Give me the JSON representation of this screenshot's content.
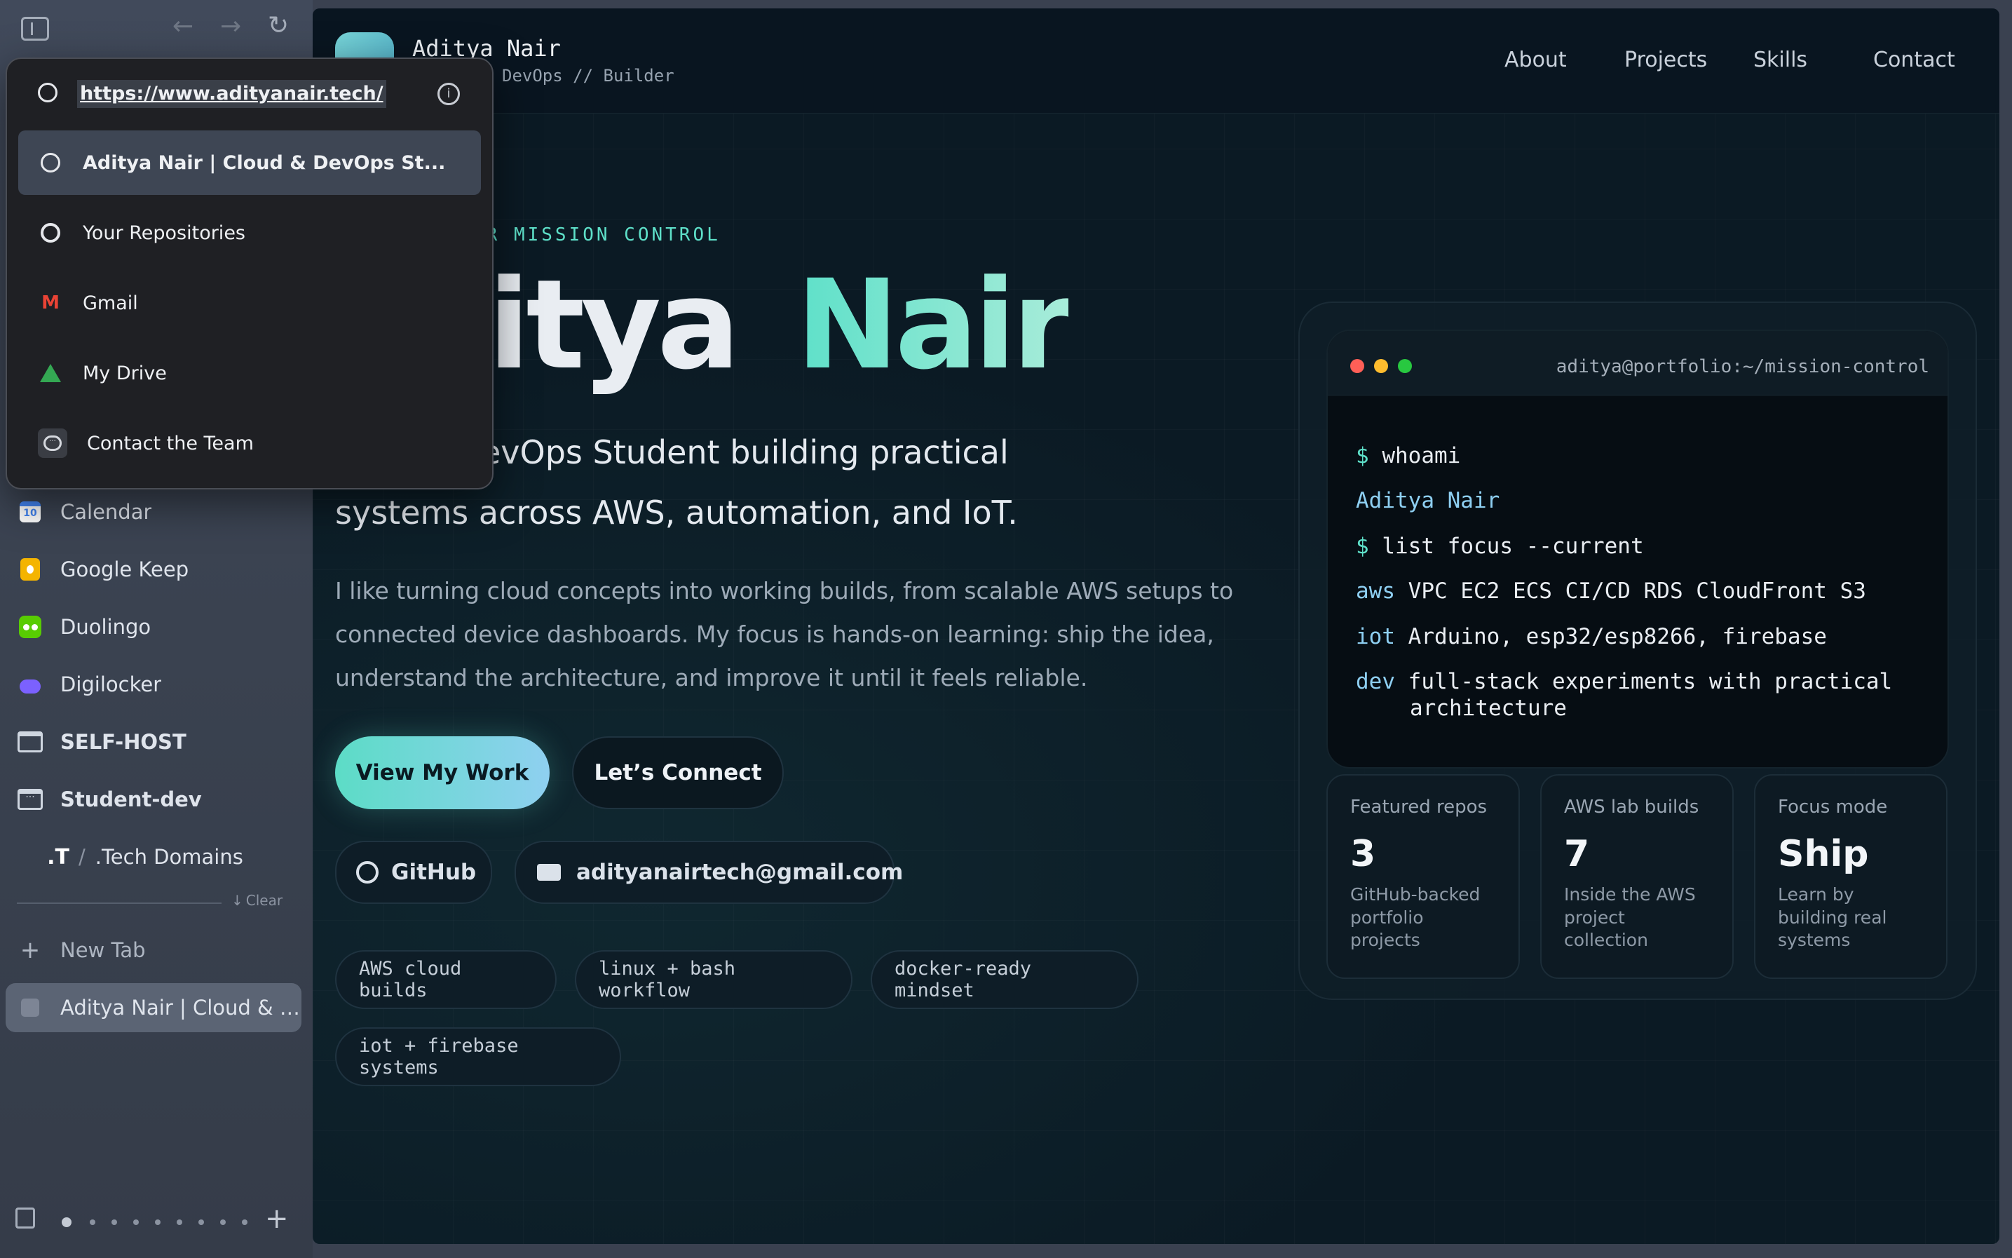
{
  "browser": {
    "url": "https://www.adityanair.tech/",
    "suggestions": [
      {
        "label": "Aditya Nair | Cloud & DevOps St...",
        "icon": "globe-icon"
      },
      {
        "label": "Your Repositories",
        "icon": "github-icon"
      },
      {
        "label": "Gmail",
        "icon": "gmail-icon"
      },
      {
        "label": "My Drive",
        "icon": "drive-icon"
      },
      {
        "label": "Contact the Team",
        "icon": "chat-icon"
      }
    ]
  },
  "sidebar": {
    "items": [
      {
        "label": "Calendar",
        "icon": "calendar-icon"
      },
      {
        "label": "Google Keep",
        "icon": "keep-icon"
      },
      {
        "label": "Duolingo",
        "icon": "duolingo-icon"
      },
      {
        "label": "Digilocker",
        "icon": "cloud-icon"
      },
      {
        "label": "SELF-HOST",
        "icon": "folder-icon"
      },
      {
        "label": "Student-dev",
        "icon": "folder-icon"
      },
      {
        "label": ".Tech Domains",
        "icon": "tech-icon"
      }
    ],
    "clear_label": "Clear",
    "new_tab_label": "New Tab",
    "active_tab_label": "Aditya Nair | Cloud & De..."
  },
  "site": {
    "brand_name": "Aditya Nair",
    "brand_sub": "DevOps // Builder",
    "nav": [
      "About",
      "Projects",
      "Skills",
      "Contact"
    ],
    "eyebrow": "ER MISSION CONTROL",
    "hero_title_a": "itya",
    "hero_title_b": "Nair",
    "subtitle_1": "evOps Student building practical",
    "subtitle_2": "systems across AWS, automation, and IoT.",
    "intro_1": "I like turning cloud concepts into working builds, from scalable AWS setups to",
    "intro_2": "connected device dashboards. My focus is hands-on learning: ship the idea,",
    "intro_3": "understand the architecture, and improve it until it feels reliable.",
    "cta_primary": "View My Work",
    "cta_secondary": "Let’s Connect",
    "github_label": "GitHub",
    "email_label": "adityanairtech@gmail.com",
    "tags": [
      "AWS cloud builds",
      "linux + bash workflow",
      "docker-ready mindset",
      "iot + firebase systems"
    ]
  },
  "terminal": {
    "title": "aditya@portfolio:~/mission-control",
    "prompt": "$",
    "cmd1": "whoami",
    "out1": "Aditya Nair",
    "cmd2": "list focus --current",
    "rows": [
      {
        "key": "aws",
        "val": "VPC EC2 ECS CI/CD RDS CloudFront S3"
      },
      {
        "key": "iot",
        "val": "Arduino, esp32/esp8266, firebase"
      },
      {
        "key": "dev",
        "val": "full-stack experiments with practical"
      }
    ],
    "dev_cont": "architecture"
  },
  "stats": [
    {
      "title": "Featured repos",
      "value": "3",
      "desc": "GitHub-backed portfolio projects"
    },
    {
      "title": "AWS lab builds",
      "value": "7",
      "desc": "Inside the AWS project collection"
    },
    {
      "title": "Focus mode",
      "value": "Ship",
      "desc": "Learn by building real systems"
    }
  ],
  "colors": {
    "accent": "#5ee0c9",
    "page_bg": "#0b1a24",
    "sidebar_bg": "#3a4250"
  }
}
